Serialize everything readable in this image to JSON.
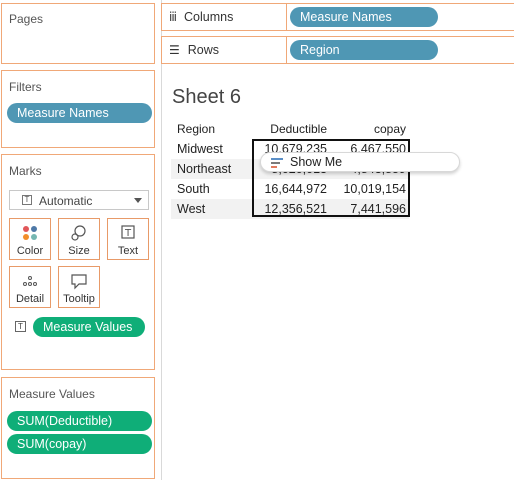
{
  "pages": {
    "title": "Pages"
  },
  "filters": {
    "title": "Filters",
    "pill": "Measure Names"
  },
  "marks": {
    "title": "Marks",
    "mark_type": "Automatic",
    "buttons": [
      "Color",
      "Size",
      "Text",
      "Detail",
      "Tooltip"
    ],
    "text_pill": "Measure Values"
  },
  "measure_values": {
    "title": "Measure Values",
    "items": [
      "SUM(Deductible)",
      "SUM(copay)"
    ]
  },
  "shelves": {
    "columns_label": "Columns",
    "columns_pill": "Measure Names",
    "rows_label": "Rows",
    "rows_pill": "Region"
  },
  "sheet": {
    "title": "Sheet 6",
    "headers": [
      "Region",
      "Deductible",
      "copay"
    ],
    "rows": [
      {
        "region": "Midwest",
        "deductible": "10,679,235",
        "copay": "6,467,550"
      },
      {
        "region": "Northeast",
        "deductible": "8,020,013",
        "copay": "4,843,859"
      },
      {
        "region": "South",
        "deductible": "16,644,972",
        "copay": "10,019,154"
      },
      {
        "region": "West",
        "deductible": "12,356,521",
        "copay": "7,441,596"
      }
    ]
  },
  "show_me": {
    "label": "Show Me"
  }
}
